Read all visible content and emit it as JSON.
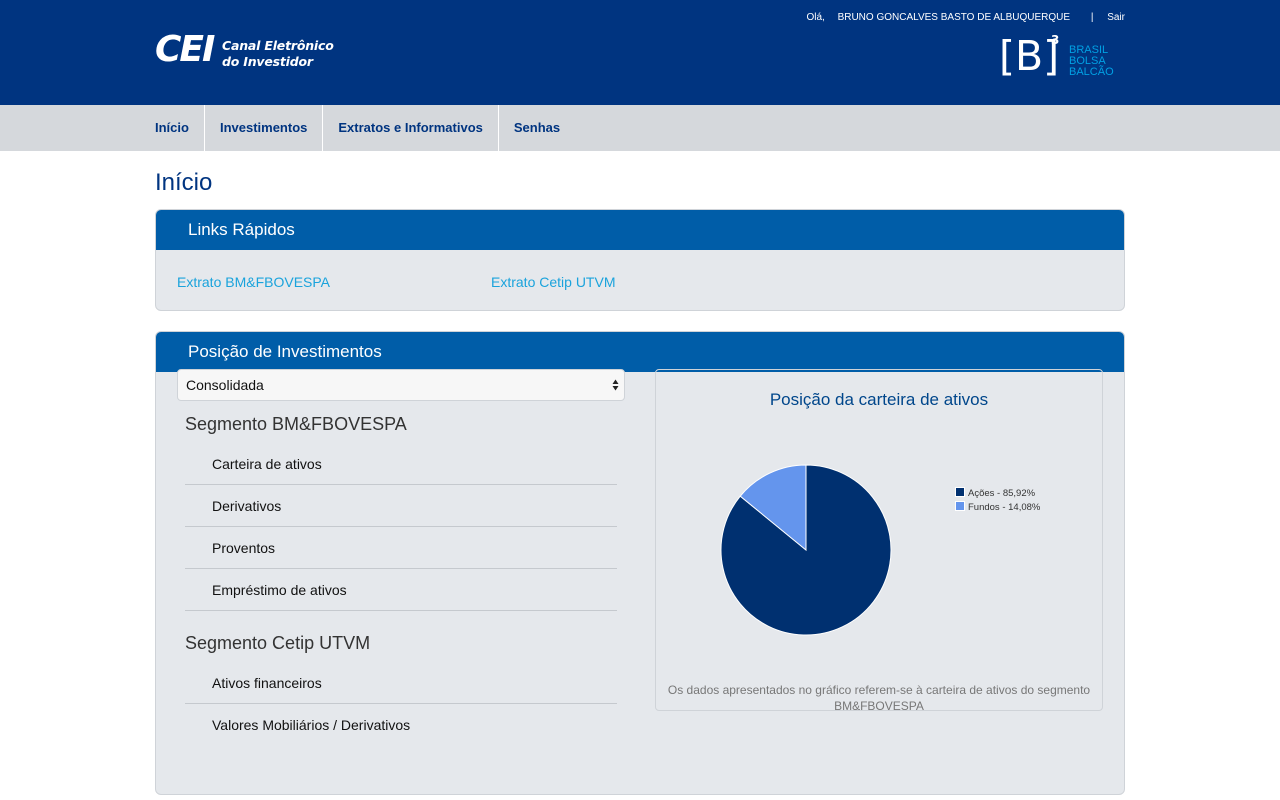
{
  "header": {
    "logo_text": "CEI",
    "logo_subtitle_line1": "Canal Eletrônico",
    "logo_subtitle_line2": "do Investidor",
    "greeting": "Olá,",
    "user_name": "BRUNO GONCALVES BASTO DE ALBUQUERQUE",
    "separator": "|",
    "logout": "Sair",
    "b3_mark": "[B]",
    "b3_superscript": "3",
    "b3_line1": "BRASIL",
    "b3_line2": "BOLSA",
    "b3_line3": "BALCÃO"
  },
  "nav": {
    "items": [
      {
        "label": "Início"
      },
      {
        "label": "Investimentos"
      },
      {
        "label": "Extratos e Informativos"
      },
      {
        "label": "Senhas"
      }
    ]
  },
  "page_title": "Início",
  "links_panel": {
    "title": "Links Rápidos",
    "links": [
      "Extrato BM&FBOVESPA",
      "Extrato Cetip UTVM"
    ]
  },
  "positions_panel": {
    "title": "Posição de Investimentos",
    "select_value": "Consolidada",
    "segment1": {
      "title": "Segmento BM&FBOVESPA",
      "items": [
        "Carteira de ativos",
        "Derivativos",
        "Proventos",
        "Empréstimo de ativos"
      ]
    },
    "segment2": {
      "title": "Segmento Cetip UTVM",
      "items": [
        "Ativos financeiros",
        "Valores Mobiliários / Derivativos"
      ]
    }
  },
  "chart": {
    "title": "Posição da carteira de ativos",
    "note": "Os dados apresentados no gráfico referem-se à carteira de ativos do segmento BM&FBOVESPA"
  },
  "chart_data": {
    "type": "pie",
    "title": "Posição da carteira de ativos",
    "legend_position": "right",
    "slices": [
      {
        "label": "Ações - 85,92%",
        "value": 85.92,
        "color": "#003070"
      },
      {
        "label": "Fundos - 14,08%",
        "value": 14.08,
        "color": "#6495ed"
      }
    ]
  },
  "colors": {
    "header_bg": "#003480",
    "panel_header": "#005da8",
    "link": "#1aa3dc",
    "accent": "#00a0e3"
  }
}
